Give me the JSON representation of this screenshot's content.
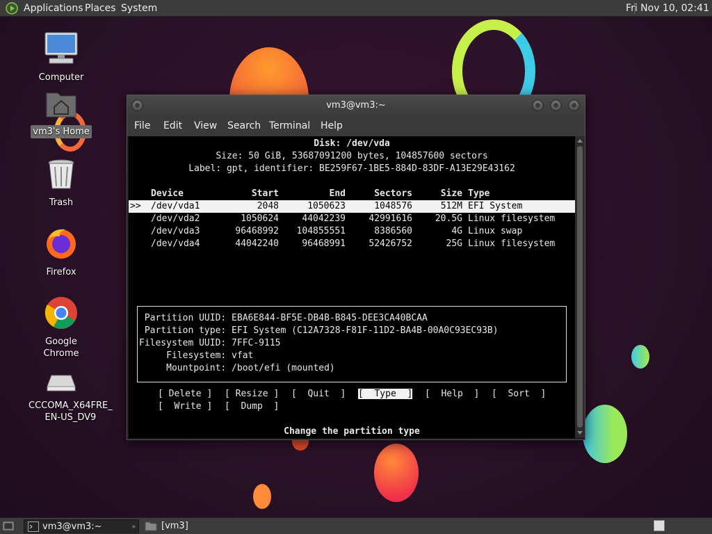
{
  "top_panel": {
    "menus": [
      "Applications",
      "Places",
      "System"
    ],
    "clock": "Fri Nov 10, 02:41"
  },
  "desktop": {
    "icons": [
      {
        "label": "Computer",
        "icon": "computer-icon"
      },
      {
        "label": "vm3's Home",
        "icon": "home-folder-icon"
      },
      {
        "label": "Trash",
        "icon": "trash-icon"
      },
      {
        "label": "Firefox",
        "icon": "firefox-icon"
      },
      {
        "label": "Google Chrome",
        "icon": "chrome-icon"
      },
      {
        "label": "CCCOMA_X64FRE_\nEN-US_DV9",
        "icon": "drive-icon"
      }
    ]
  },
  "terminal": {
    "title": "vm3@vm3:~",
    "menus": [
      "File",
      "Edit",
      "View",
      "Search",
      "Terminal",
      "Help"
    ],
    "disk": {
      "header": "Disk: /dev/vda",
      "size_line": "Size: 50 GiB, 53687091200 bytes, 104857600 sectors",
      "label_line": "Label: gpt, identifier: BE259F67-1BE5-884D-83DF-A13E29E43162"
    },
    "columns": [
      "Device",
      "Start",
      "End",
      "Sectors",
      "Size",
      "Type"
    ],
    "selector": ">>",
    "rows": [
      {
        "device": "/dev/vda1",
        "start": "2048",
        "end": "1050623",
        "sectors": "1048576",
        "size": "512M",
        "type": "EFI System"
      },
      {
        "device": "/dev/vda2",
        "start": "1050624",
        "end": "44042239",
        "sectors": "42991616",
        "size": "20.5G",
        "type": "Linux filesystem"
      },
      {
        "device": "/dev/vda3",
        "start": "96468992",
        "end": "104855551",
        "sectors": "8386560",
        "size": "4G",
        "type": "Linux swap"
      },
      {
        "device": "/dev/vda4",
        "start": "44042240",
        "end": "96468991",
        "sectors": "52426752",
        "size": "25G",
        "type": "Linux filesystem"
      }
    ],
    "info": [
      " Partition UUID: EBA6E844-BF5E-DB4B-B845-DEE3CA40BCAA",
      " Partition type: EFI System (C12A7328-F81F-11D2-BA4B-00A0C93EC93B)",
      "Filesystem UUID: 7FFC-9115",
      "     Filesystem: vfat",
      "     Mountpoint: /boot/efi (mounted)"
    ],
    "commands": [
      "Delete",
      "Resize",
      "Quit",
      "Type",
      "Help",
      "Sort",
      "Write",
      "Dump"
    ],
    "selected_command": "Type",
    "status": "Change the partition type"
  },
  "bottom_panel": {
    "tasks": [
      "vm3@vm3:~",
      "[vm3]"
    ]
  }
}
